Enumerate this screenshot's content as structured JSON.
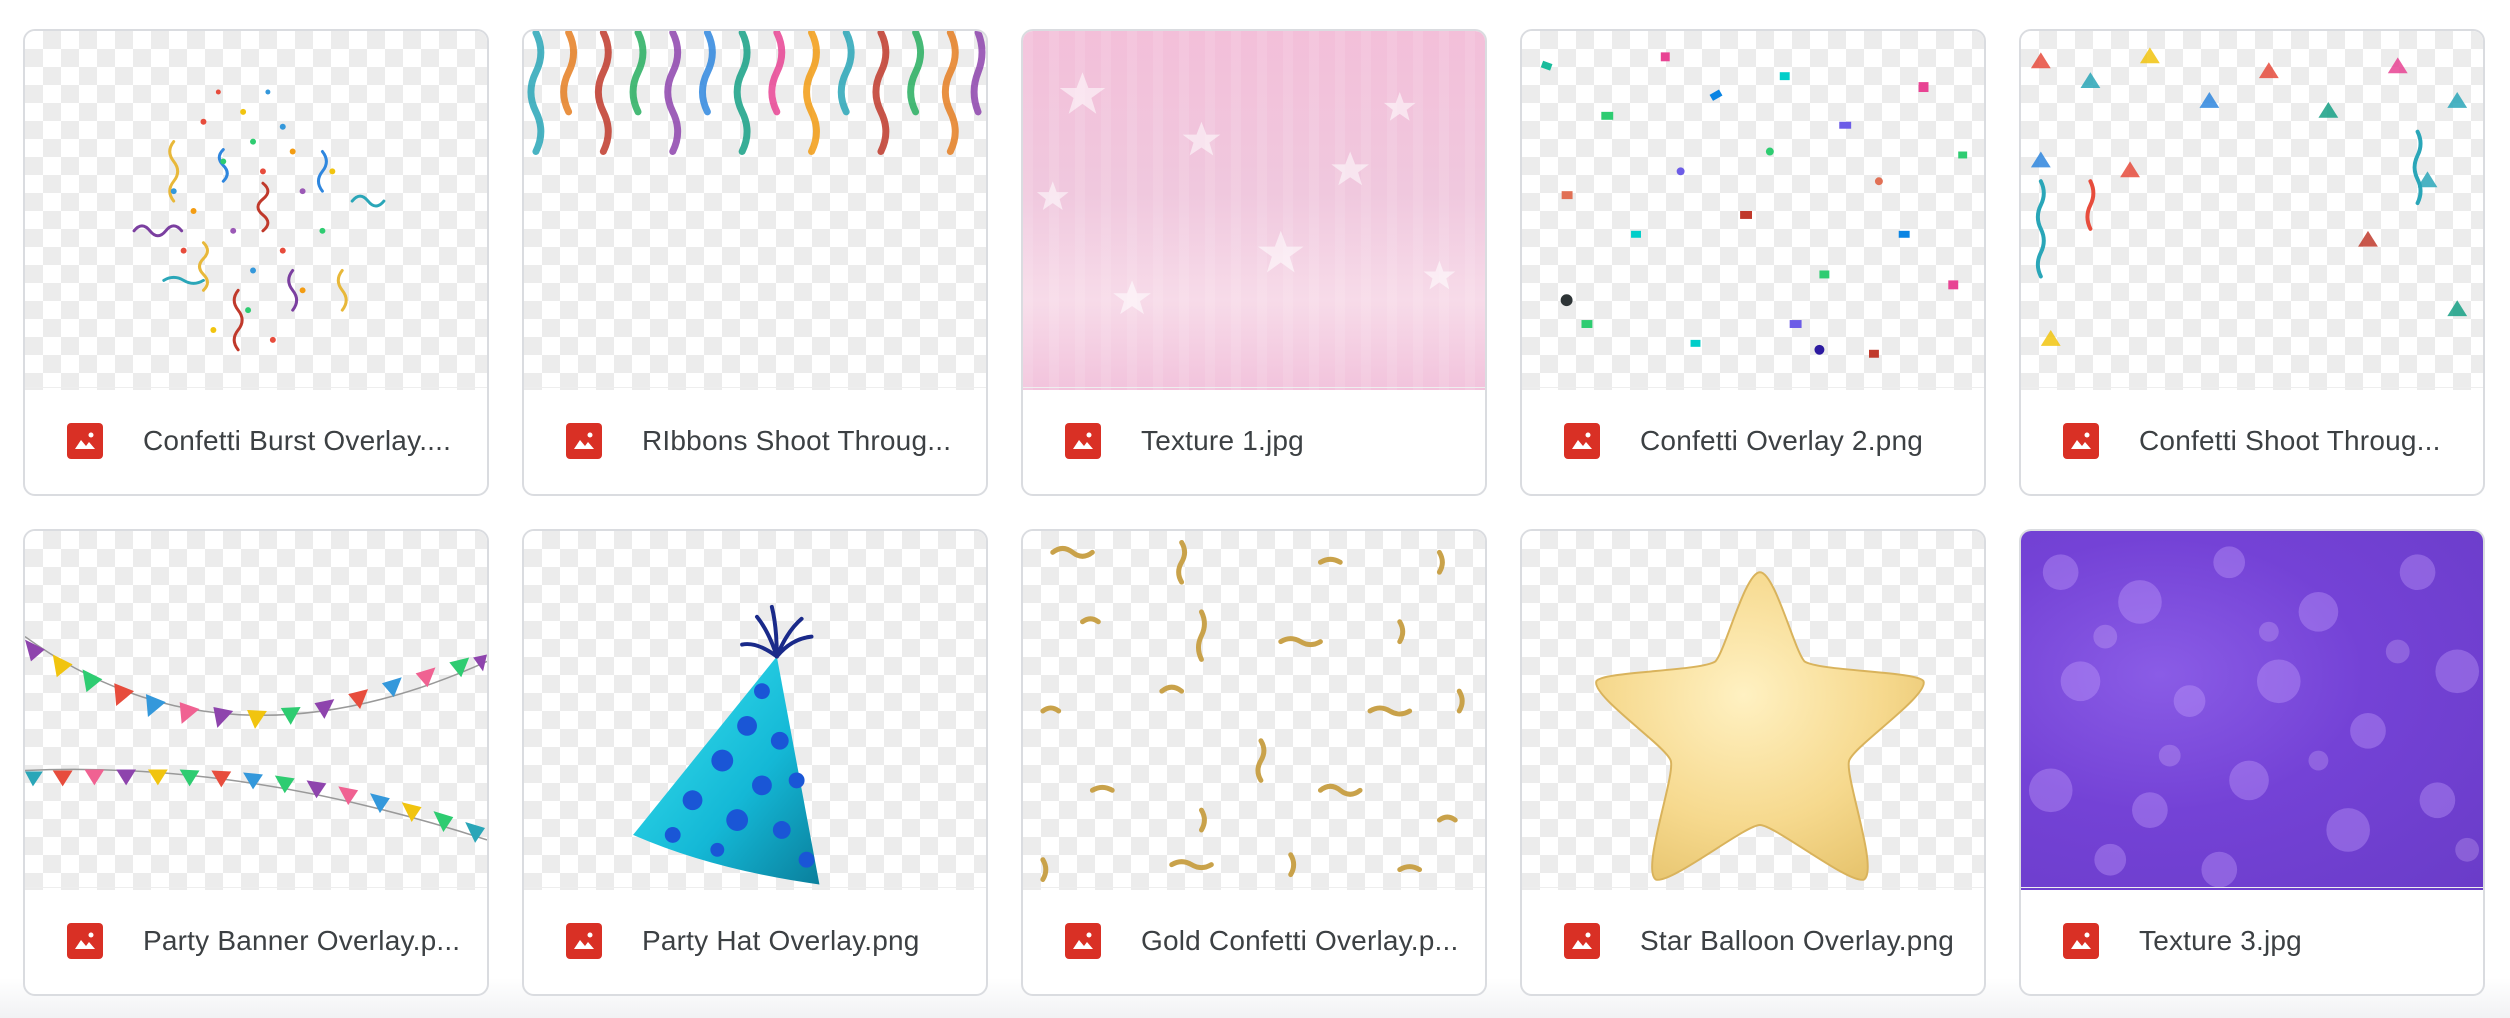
{
  "files": [
    {
      "name": "Confetti Burst Overlay....",
      "icon": "image-file-icon",
      "thumbnail": "confetti-burst"
    },
    {
      "name": "RIbbons Shoot Throug...",
      "icon": "image-file-icon",
      "thumbnail": "ribbons"
    },
    {
      "name": "Texture 1.jpg",
      "icon": "image-file-icon",
      "thumbnail": "pink-star-texture"
    },
    {
      "name": "Confetti Overlay 2.png",
      "icon": "image-file-icon",
      "thumbnail": "confetti-scatter"
    },
    {
      "name": "Confetti Shoot Throug...",
      "icon": "image-file-icon",
      "thumbnail": "confetti-shoot"
    },
    {
      "name": "Party Banner Overlay.p...",
      "icon": "image-file-icon",
      "thumbnail": "party-banner"
    },
    {
      "name": "Party Hat Overlay.png",
      "icon": "image-file-icon",
      "thumbnail": "party-hat"
    },
    {
      "name": "Gold Confetti Overlay.p...",
      "icon": "image-file-icon",
      "thumbnail": "gold-confetti"
    },
    {
      "name": "Star Balloon Overlay.png",
      "icon": "image-file-icon",
      "thumbnail": "star-balloon"
    },
    {
      "name": "Texture 3.jpg",
      "icon": "image-file-icon",
      "thumbnail": "purple-bokeh-texture"
    }
  ],
  "colors": {
    "file_icon": "#d93025",
    "card_border": "#dadce0",
    "text": "#3c4043"
  }
}
